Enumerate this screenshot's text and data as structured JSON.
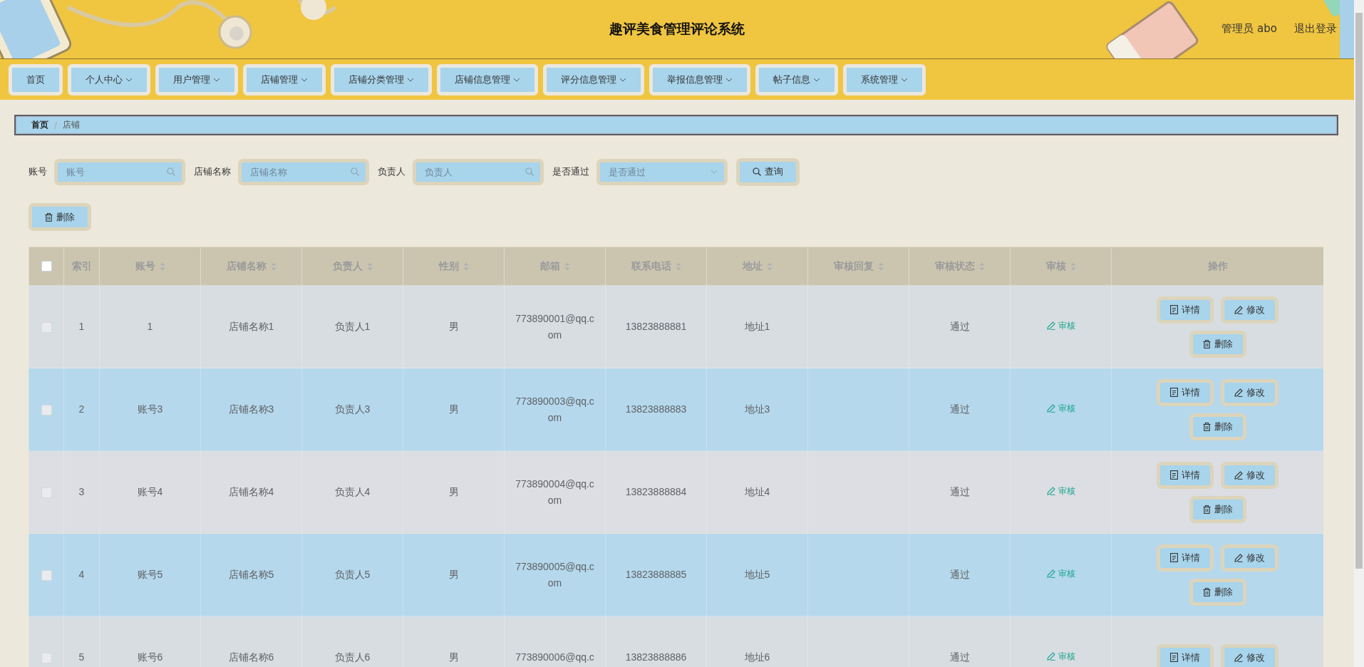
{
  "header": {
    "title": "趣评美食管理评论系统",
    "user": "管理员 abo",
    "logout": "退出登录"
  },
  "nav": [
    {
      "label": "首页",
      "has_menu": false
    },
    {
      "label": "个人中心",
      "has_menu": true
    },
    {
      "label": "用户管理",
      "has_menu": true
    },
    {
      "label": "店铺管理",
      "has_menu": true
    },
    {
      "label": "店铺分类管理",
      "has_menu": true
    },
    {
      "label": "店铺信息管理",
      "has_menu": true
    },
    {
      "label": "评分信息管理",
      "has_menu": true
    },
    {
      "label": "举报信息管理",
      "has_menu": true
    },
    {
      "label": "帖子信息",
      "has_menu": true
    },
    {
      "label": "系统管理",
      "has_menu": true
    }
  ],
  "breadcrumb": {
    "separator": "/",
    "items": [
      {
        "label": "首页",
        "current": false
      },
      {
        "label": "店铺",
        "current": true
      }
    ]
  },
  "search": {
    "fields": [
      {
        "label": "账号",
        "kind": "text",
        "placeholder": "账号"
      },
      {
        "label": "店铺名称",
        "kind": "text",
        "placeholder": "店铺名称"
      },
      {
        "label": "负责人",
        "kind": "text",
        "placeholder": "负责人"
      },
      {
        "label": "是否通过",
        "kind": "select",
        "placeholder": "是否通过"
      }
    ],
    "button": "查询"
  },
  "toolbar": {
    "delete_button": "删除"
  },
  "table": {
    "select_all": {
      "checked": false
    },
    "columns": [
      {
        "label": "索引",
        "sortable": false
      },
      {
        "label": "账号",
        "sortable": true
      },
      {
        "label": "店铺名称",
        "sortable": true
      },
      {
        "label": "负责人",
        "sortable": true
      },
      {
        "label": "性别",
        "sortable": true
      },
      {
        "label": "邮箱",
        "sortable": true
      },
      {
        "label": "联系电话",
        "sortable": true
      },
      {
        "label": "地址",
        "sortable": true
      },
      {
        "label": "审核回复",
        "sortable": true
      },
      {
        "label": "审核状态",
        "sortable": true
      },
      {
        "label": "审核",
        "sortable": true
      },
      {
        "label": "操作",
        "sortable": false
      }
    ],
    "rows": [
      {
        "checked": false,
        "index": "1",
        "account": "1",
        "shop_name": "店铺名称1",
        "owner": "负责人1",
        "gender": "男",
        "email": "773890001@qq.com",
        "phone": "13823888881",
        "address": "地址1",
        "status": "通过",
        "review": "审核",
        "actions": [
          {
            "kind": "detail",
            "label": "详情"
          },
          {
            "kind": "edit",
            "label": "修改"
          },
          {
            "kind": "delete",
            "label": "删除"
          }
        ]
      },
      {
        "checked": false,
        "index": "2",
        "account": "账号3",
        "shop_name": "店铺名称3",
        "owner": "负责人3",
        "gender": "男",
        "email": "773890003@qq.com",
        "phone": "13823888883",
        "address": "地址3",
        "status": "通过",
        "review": "审核",
        "actions": [
          {
            "kind": "detail",
            "label": "详情"
          },
          {
            "kind": "edit",
            "label": "修改"
          },
          {
            "kind": "delete",
            "label": "删除"
          }
        ]
      },
      {
        "checked": false,
        "index": "3",
        "account": "账号4",
        "shop_name": "店铺名称4",
        "owner": "负责人4",
        "gender": "男",
        "email": "773890004@qq.com",
        "phone": "13823888884",
        "address": "地址4",
        "status": "通过",
        "review": "审核",
        "actions": [
          {
            "kind": "detail",
            "label": "详情"
          },
          {
            "kind": "edit",
            "label": "修改"
          },
          {
            "kind": "delete",
            "label": "删除"
          }
        ]
      },
      {
        "checked": false,
        "index": "4",
        "account": "账号5",
        "shop_name": "店铺名称5",
        "owner": "负责人5",
        "gender": "男",
        "email": "773890005@qq.com",
        "phone": "13823888885",
        "address": "地址5",
        "status": "通过",
        "review": "审核",
        "actions": [
          {
            "kind": "detail",
            "label": "详情"
          },
          {
            "kind": "edit",
            "label": "修改"
          },
          {
            "kind": "delete",
            "label": "删除"
          }
        ]
      },
      {
        "checked": false,
        "index": "5",
        "account": "账号6",
        "shop_name": "店铺名称6",
        "owner": "负责人6",
        "gender": "男",
        "email": "773890006@qq.c",
        "phone": "13823888886",
        "address": "地址6",
        "status": "通过",
        "review": "审核",
        "actions": [
          {
            "kind": "detail",
            "label": "详情"
          },
          {
            "kind": "edit",
            "label": "修改"
          }
        ]
      }
    ]
  }
}
